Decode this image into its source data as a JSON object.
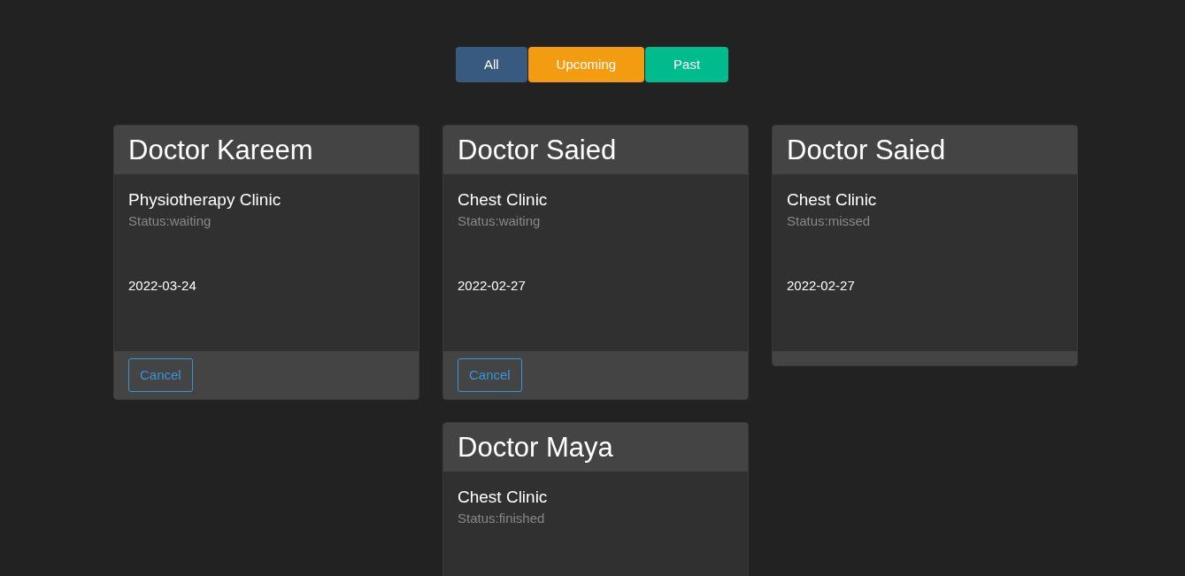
{
  "filters": [
    {
      "label": "All",
      "color": "#395a7f"
    },
    {
      "label": "Upcoming",
      "color": "#f39c12"
    },
    {
      "label": "Past",
      "color": "#00bc8c"
    }
  ],
  "appointments": [
    {
      "doctor": "Doctor Kareem",
      "clinic": "Physiotherapy Clinic",
      "status": "Status:waiting",
      "date": "2022-03-24",
      "actions": [
        "Cancel"
      ]
    },
    {
      "doctor": "Doctor Saied",
      "clinic": "Chest Clinic",
      "status": "Status:waiting",
      "date": "2022-02-27",
      "actions": [
        "Cancel"
      ]
    },
    {
      "doctor": "Doctor Saied",
      "clinic": "Chest Clinic",
      "status": "Status:missed",
      "date": "2022-02-27"
    },
    {
      "doctor": "Doctor Maya",
      "clinic": "Chest Clinic",
      "status": "Status:finished"
    }
  ]
}
